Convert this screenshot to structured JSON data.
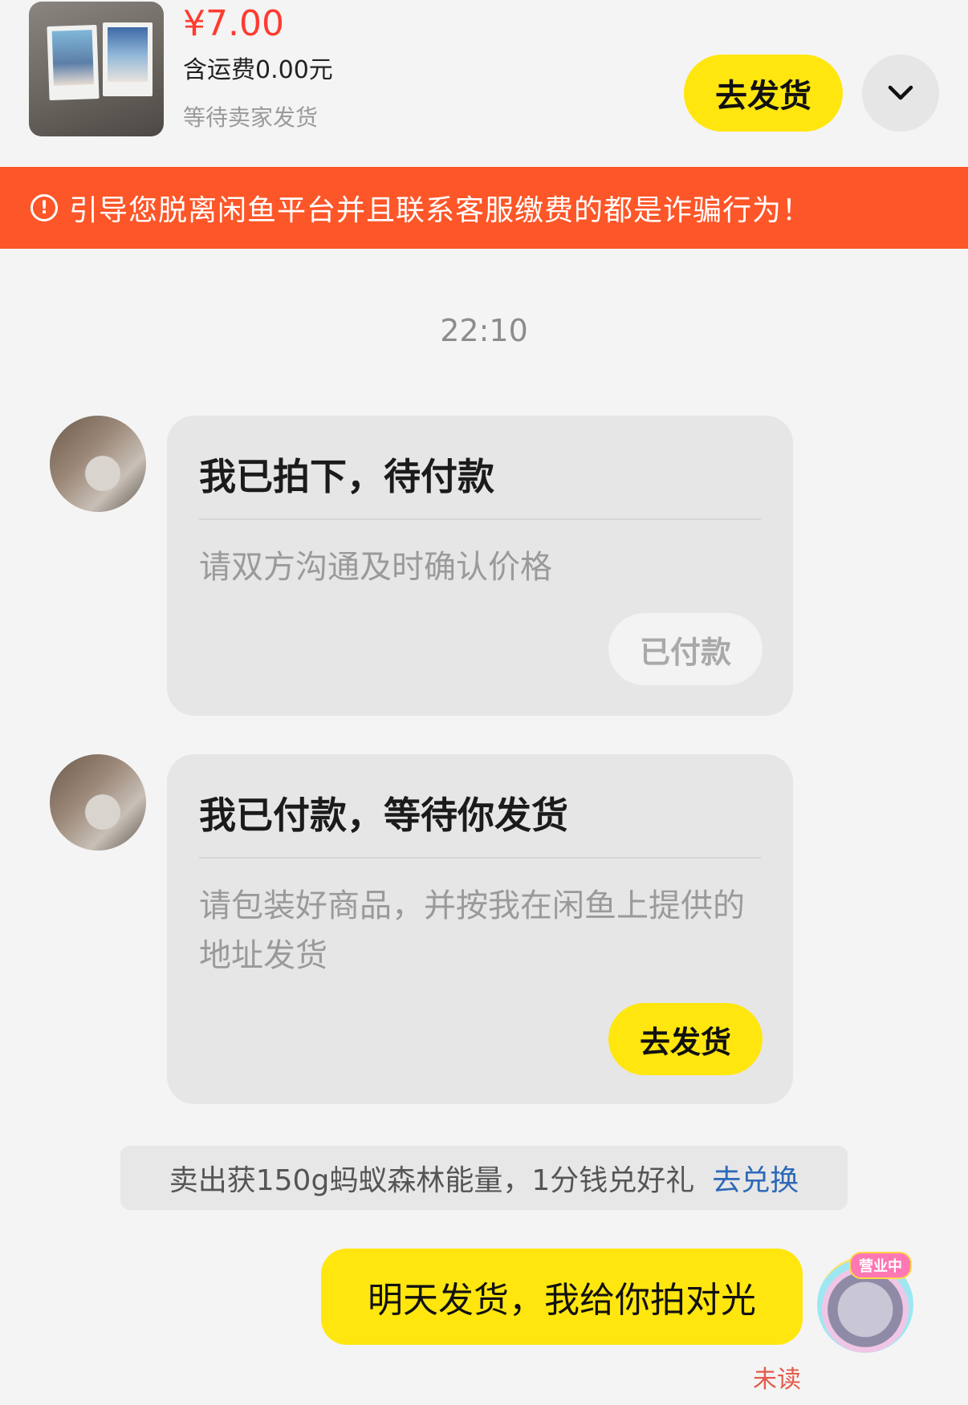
{
  "header": {
    "price": "¥7.00",
    "shipping": "含运费0.00元",
    "status": "等待卖家发货",
    "ship_button": "去发货",
    "more_icon": "chevron-down-icon"
  },
  "warning": {
    "icon": "exclamation-circle-icon",
    "text": "引导您脱离闲鱼平台并且联系客服缴费的都是诈骗行为！"
  },
  "chat": {
    "timestamp": "22:10",
    "cards": [
      {
        "title": "我已拍下，待付款",
        "description": "请双方沟通及时确认价格",
        "button": "已付款",
        "button_enabled": false
      },
      {
        "title": "我已付款，等待你发货",
        "description": "请包装好商品，并按我在闲鱼上提供的地址发货",
        "button": "去发货",
        "button_enabled": true
      }
    ],
    "promo": {
      "text": "卖出获150g蚂蚁森林能量，1分钱兑好礼",
      "link": "去兑换"
    },
    "my_message": {
      "text": "明天发货，我给你拍对光",
      "avatar_badge": "营业中",
      "read_status": "未读"
    }
  },
  "colors": {
    "accent_yellow": "#ffe60f",
    "price_red": "#ff3b30",
    "warning_orange": "#fd5628",
    "link_blue": "#2e69b8"
  }
}
